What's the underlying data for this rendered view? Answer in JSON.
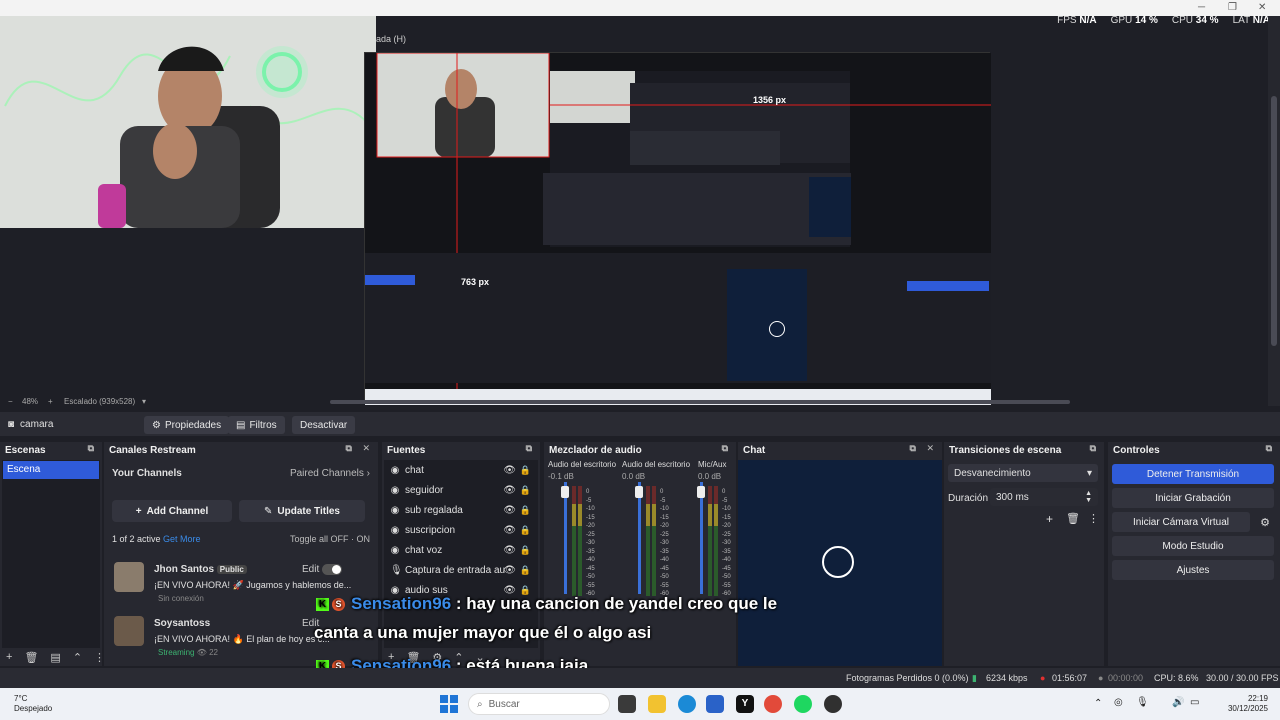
{
  "topbar": {
    "menu_fragment": "ada (H)"
  },
  "stats": {
    "fps_label": "FPS",
    "fps": "N/A",
    "gpu_label": "GPU",
    "gpu": "14 %",
    "cpu_label": "CPU",
    "cpu": "34 %",
    "lat_label": "LAT",
    "lat": "N/A"
  },
  "preview": {
    "px_label_top": "1356 px",
    "px_label_left": "763 px",
    "zoom": "48%",
    "scale": "Escalado (939x528)"
  },
  "scenebar": {
    "source_name": "camara",
    "properties": "Propiedades",
    "filters": "Filtros",
    "deactivate": "Desactivar"
  },
  "scenes": {
    "title": "Escenas",
    "items": [
      "Escena"
    ]
  },
  "restream": {
    "title": "Canales Restream",
    "your_channels": "Your Channels",
    "paired_channels": "Paired Channels",
    "add_channel": "Add Channel",
    "update_titles": "Update Titles",
    "active": "1 of 2 active",
    "get_more": "Get More",
    "toggle_all": "Toggle all OFF",
    "on": "ON",
    "channels": [
      {
        "name": "Jhon Santos",
        "badge": "Public",
        "edit": "Edit",
        "title": "¡EN VIVO AHORA! 🚀 Jugamos y hablemos de...",
        "status": "Sin conexión"
      },
      {
        "name": "Soysantoss",
        "badge": "",
        "edit": "Edit",
        "title": "¡EN VIVO AHORA! 🔥 El plan de hoy es c...",
        "status": "Streaming",
        "viewers": "22"
      }
    ]
  },
  "sources": {
    "title": "Fuentes",
    "items": [
      "chat",
      "seguidor",
      "sub regalada",
      "suscripcion",
      "chat voz",
      "Captura de entrada au",
      "audio sus"
    ]
  },
  "mixer": {
    "title": "Mezclador de audio",
    "channels": [
      {
        "name": "Audio del escritorio",
        "db": "-0.1 dB"
      },
      {
        "name": "Audio del escritorio",
        "db": "0.0 dB"
      },
      {
        "name": "Mic/Aux",
        "db": "0.0 dB"
      }
    ],
    "scale": [
      "0",
      "-5",
      "-10",
      "-15",
      "-20",
      "-25",
      "-30",
      "-35",
      "-40",
      "-45",
      "-50",
      "-55",
      "-60"
    ]
  },
  "chat": {
    "title": "Chat"
  },
  "transitions": {
    "title": "Transiciones de escena",
    "selected": "Desvanecimiento",
    "duration_label": "Duración",
    "duration": "300 ms"
  },
  "controls": {
    "title": "Controles",
    "buttons": [
      "Detener Transmisión",
      "Iniciar Grabación",
      "Iniciar Cámara Virtual",
      "Modo Estudio",
      "Ajustes"
    ],
    "accent": "#2f5bd9"
  },
  "overlay": {
    "line1_user": "Sensation96",
    "line1_text": " : hay una cancion de yandel creo que le",
    "line2_text": "canta a una mujer mayor que él o algo asi",
    "line3_user": "Sensation96",
    "line3_text": " : está buena jaja",
    "badge_k": "K",
    "badge_s": "S"
  },
  "statusbar": {
    "dropped": "Fotogramas Perdidos 0 (0.0%)",
    "bitrate": "6234 kbps",
    "stream_time": "01:56:07",
    "rec_time": "00:00:00",
    "cpu": "CPU: 8.6%",
    "fps": "30.00 / 30.00 FPS"
  },
  "taskbar": {
    "temp": "7°C",
    "weather": "Despejado",
    "search": "Buscar",
    "time": "22:19",
    "date": "30/12/2025"
  }
}
